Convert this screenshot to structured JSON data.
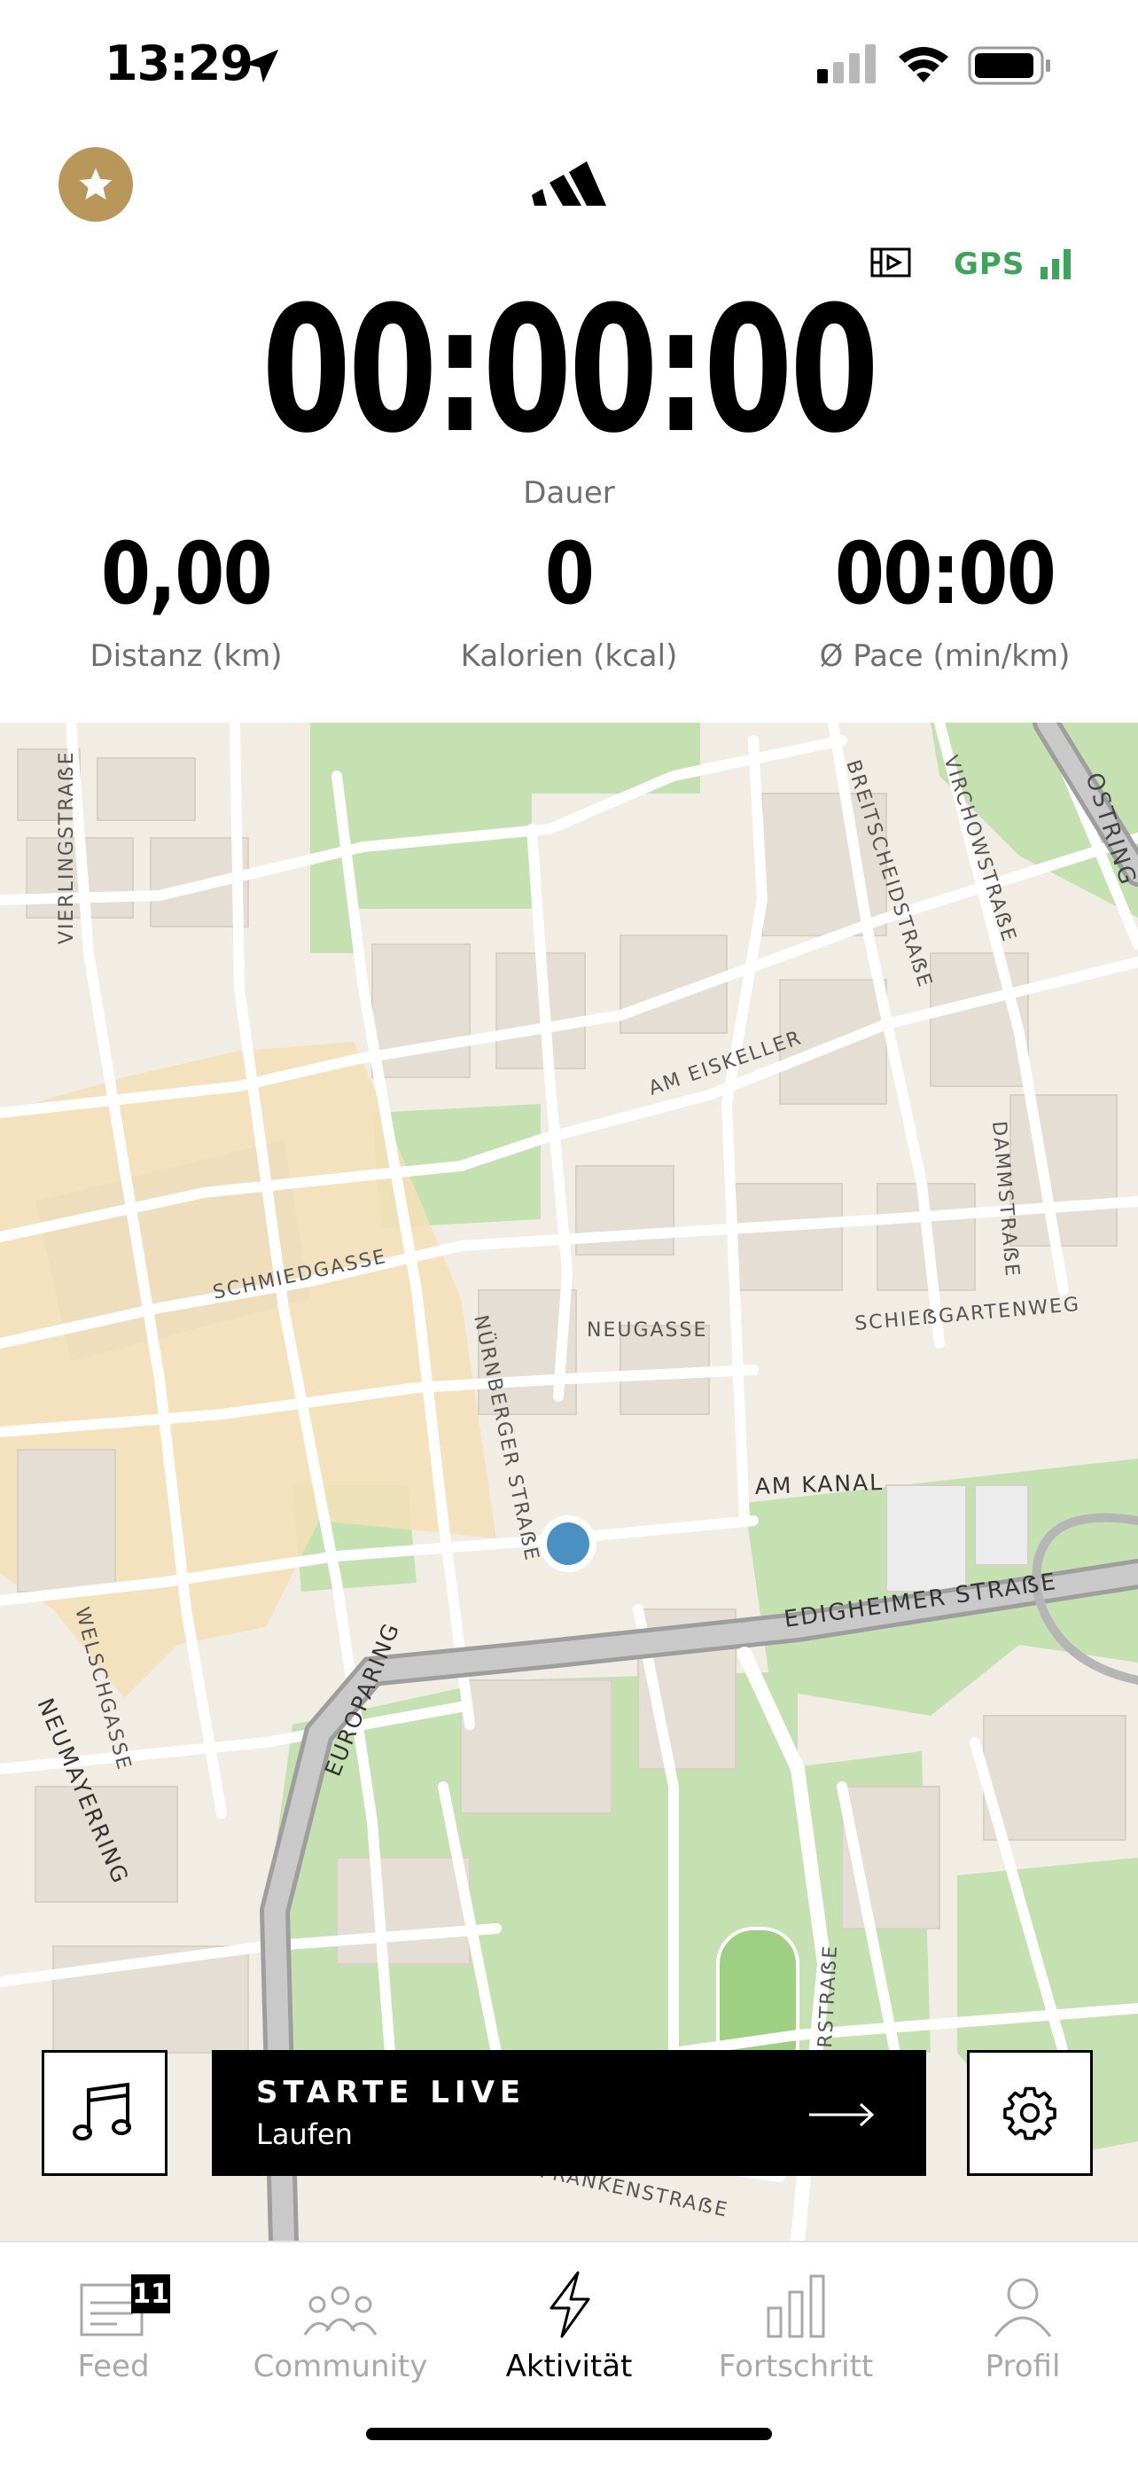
{
  "status_bar": {
    "time": "13:29"
  },
  "header": {
    "gps_label": "GPS"
  },
  "timer": {
    "value": "00:00:00",
    "label": "Dauer"
  },
  "stats": [
    {
      "value": "0,00",
      "label": "Distanz (km)"
    },
    {
      "value": "0",
      "label": "Kalorien (kcal)"
    },
    {
      "value": "00:00",
      "label": "Ø Pace (min/km)"
    }
  ],
  "map": {
    "street_labels": [
      "VIERLINGSTRAẞE",
      "OSTRING",
      "BREITSCHEIDSTRAẞE",
      "VIRCHOWSTRAẞE",
      "AM EISKELLER",
      "DAMMSTRAẞE",
      "SCHMIEDGASSE",
      "NÜRNBERGER STRAẞE",
      "NEUGASSE",
      "SCHIEẞGARTENWEG",
      "AM KANAL",
      "EDIGHEIMER STRAẞE",
      "WELSCHGASSE",
      "EUROPARING",
      "NEUMAYERRING",
      "RSTRAẞE",
      "FRANKENSTRAẞE"
    ]
  },
  "start_button": {
    "title": "STARTE LIVE",
    "subtitle": "Laufen"
  },
  "tabs": [
    {
      "label": "Feed",
      "badge": "11"
    },
    {
      "label": "Community"
    },
    {
      "label": "Aktivität"
    },
    {
      "label": "Fortschritt"
    },
    {
      "label": "Profil"
    }
  ],
  "colors": {
    "accent_gold": "#b9975b",
    "gps_green": "#3da45a",
    "location_dot": "#4a90c2"
  }
}
